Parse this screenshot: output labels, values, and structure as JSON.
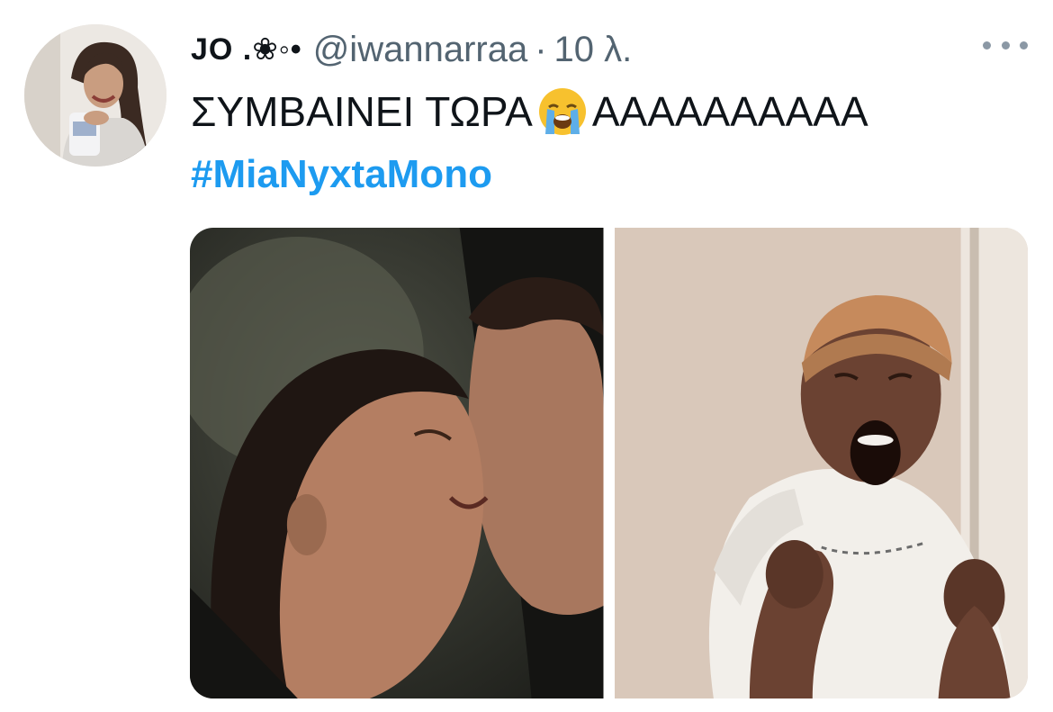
{
  "tweet": {
    "author": {
      "display_name": "JO .❀◦•",
      "handle": "@iwannarraa",
      "separator": "·",
      "time": "10 λ."
    },
    "text": {
      "before_emoji": "ΣΥΜΒΑΙΝΕΙ ΤΩΡΑ",
      "emoji": "loudly-crying-face",
      "after_emoji": "ΑΑΑΑΑΑΑΑΑΑ"
    },
    "hashtag": "#MiaNyxtaMono",
    "media": [
      {
        "name": "kissing-couple-photo"
      },
      {
        "name": "screaming-excited-woman-photo"
      }
    ]
  },
  "colors": {
    "text_primary": "#0f1419",
    "text_secondary": "#536471",
    "link": "#1d9bf0"
  },
  "icons": {
    "more": "more-horizontal-icon",
    "emoji": "loudly-crying-face-emoji"
  }
}
